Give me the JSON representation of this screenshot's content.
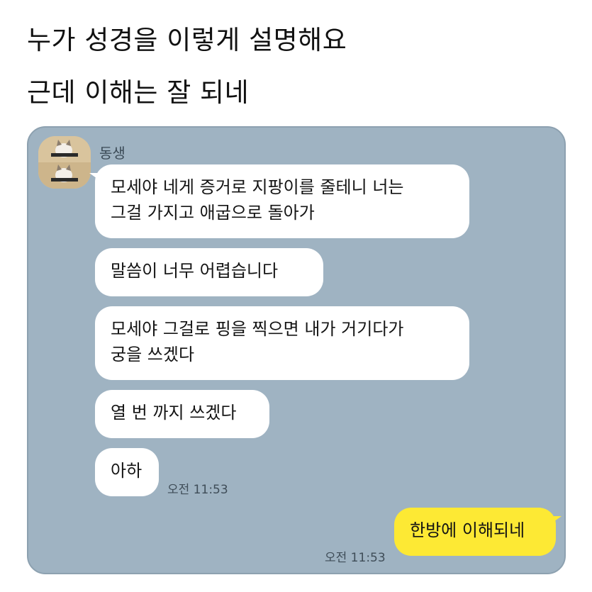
{
  "headline": {
    "line1": "누가 성경을 이렇게 설명해요",
    "line2": "근데 이해는 잘 되네"
  },
  "chat": {
    "sender_name": "동생",
    "avatar_icon": "cat-avatar-icon",
    "messages_in": [
      "모세야 네게 증거로 지팡이를 줄테니 너는\n그걸 가지고 애굽으로 돌아가",
      "말씀이 너무 어렵습니다",
      "모세야 그걸로 핑을 찍으면 내가 거기다가\n궁을 쓰겠다",
      "열 번 까지 쓰겠다",
      "아하"
    ],
    "time_in": "오전 11:53",
    "message_out": "한방에 이해되네",
    "time_out": "오전 11:53",
    "colors": {
      "background": "#9fb3c2",
      "bubble_in": "#ffffff",
      "bubble_out": "#fde934"
    }
  }
}
